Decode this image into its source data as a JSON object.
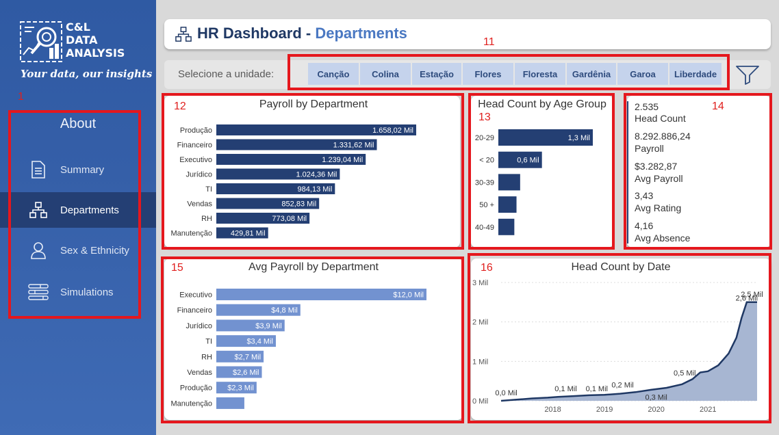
{
  "sidebar": {
    "brand": [
      "C&L",
      "DATA",
      "ANALYSIS"
    ],
    "tagline": "Your data, our insights",
    "annotation": "1",
    "about_label": "About",
    "items": [
      {
        "label": "Summary",
        "icon": "document-icon",
        "active": false
      },
      {
        "label": "Departments",
        "icon": "org-chart-icon",
        "active": true
      },
      {
        "label": "Sex & Ethnicity",
        "icon": "person-icon",
        "active": false
      },
      {
        "label": "Simulations",
        "icon": "sliders-icon",
        "active": false
      }
    ]
  },
  "header": {
    "title_main": "HR Dashboard - ",
    "title_sub": "Departments",
    "icon": "org-chart-icon"
  },
  "filter": {
    "annotation": "11",
    "label": "Selecione a unidade:",
    "units": [
      "Canção",
      "Colina",
      "Estação",
      "Flores",
      "Floresta",
      "Gardênia",
      "Garoa",
      "Liberdade"
    ],
    "icon": "funnel-icon"
  },
  "kpis": {
    "annotation": "14",
    "items": [
      {
        "value": "2.535",
        "label": "Head Count"
      },
      {
        "value": "8.292.886,24",
        "label": "Payroll"
      },
      {
        "value": "$3.282,87",
        "label": "Avg Payroll"
      },
      {
        "value": "3,43",
        "label": "Avg Rating"
      },
      {
        "value": "4,16",
        "label": "Avg Absence"
      }
    ]
  },
  "chart_data": [
    {
      "id": "payroll",
      "annotation": "12",
      "type": "bar",
      "orientation": "horizontal",
      "title": "Payroll by Department",
      "categories": [
        "Produção",
        "Financeiro",
        "Executivo",
        "Jurídico",
        "TI",
        "Vendas",
        "RH",
        "Manutenção"
      ],
      "values": [
        1658.02,
        1331.62,
        1239.04,
        1024.36,
        984.13,
        852.83,
        773.08,
        429.81
      ],
      "data_labels": [
        "1.658,02 Mil",
        "1.331,62 Mil",
        "1.239,04 Mil",
        "1.024,36 Mil",
        "984,13 Mil",
        "852,83 Mil",
        "773,08 Mil",
        "429,81 Mil"
      ],
      "color": "#243f73"
    },
    {
      "id": "agegroup",
      "annotation": "13",
      "type": "bar",
      "orientation": "horizontal",
      "title": "Head Count by Age Group",
      "categories": [
        "20-29",
        "< 20",
        "30-39",
        "50 +",
        "40-49"
      ],
      "values": [
        1.3,
        0.6,
        0.3,
        0.25,
        0.22
      ],
      "data_labels": [
        "1,3 Mil",
        "0,6 Mil",
        "",
        "",
        ""
      ],
      "color": "#243f73"
    },
    {
      "id": "avgpayroll",
      "annotation": "15",
      "type": "bar",
      "orientation": "horizontal",
      "title": "Avg Payroll by Department",
      "categories": [
        "Executivo",
        "Financeiro",
        "Jurídico",
        "TI",
        "RH",
        "Vendas",
        "Produção",
        "Manutenção"
      ],
      "values": [
        12.0,
        4.8,
        3.9,
        3.4,
        2.7,
        2.6,
        2.3,
        1.6
      ],
      "data_labels": [
        "$12,0 Mil",
        "$4,8 Mil",
        "$3,9 Mil",
        "$3,4 Mil",
        "$2,7 Mil",
        "$2,6 Mil",
        "$2,3 Mil",
        ""
      ],
      "color": "#7292d0"
    },
    {
      "id": "headcountdate",
      "annotation": "16",
      "type": "area",
      "title": "Head Count by Date",
      "y_ticks": [
        "0 Mil",
        "1 Mil",
        "2 Mil",
        "3 Mil"
      ],
      "ylim": [
        0,
        3
      ],
      "x_ticks": [
        "2018",
        "2019",
        "2020",
        "2021"
      ],
      "x_tick_values": [
        2018,
        2019,
        2020,
        2021
      ],
      "xlim": [
        2017,
        2021.95
      ],
      "series": [
        {
          "x": [
            2017.0,
            2017.3,
            2017.6,
            2017.9,
            2018.1,
            2018.4,
            2018.7,
            2019.0,
            2019.3,
            2019.6,
            2019.9,
            2020.2,
            2020.5,
            2020.7,
            2020.85,
            2021.0,
            2021.2,
            2021.4,
            2021.55,
            2021.65,
            2021.75,
            2021.85,
            2021.95
          ],
          "y": [
            0.0,
            0.03,
            0.06,
            0.08,
            0.1,
            0.12,
            0.14,
            0.15,
            0.18,
            0.22,
            0.28,
            0.33,
            0.42,
            0.55,
            0.72,
            0.75,
            0.9,
            1.2,
            1.6,
            2.1,
            2.5,
            2.5,
            2.5
          ]
        }
      ],
      "point_labels": [
        {
          "x": 2017.1,
          "y": 0.0,
          "text": "0,0 Mil"
        },
        {
          "x": 2018.25,
          "y": 0.1,
          "text": "0,1 Mil"
        },
        {
          "x": 2018.85,
          "y": 0.1,
          "text": "0,1 Mil"
        },
        {
          "x": 2019.35,
          "y": 0.2,
          "text": "0,2 Mil"
        },
        {
          "x": 2020.0,
          "y": 0.3,
          "text": "0,3 Mil",
          "below": true
        },
        {
          "x": 2020.55,
          "y": 0.5,
          "text": "0,5 Mil"
        },
        {
          "x": 2021.75,
          "y": 2.4,
          "text": "2,6 Mil"
        },
        {
          "x": 2021.85,
          "y": 2.5,
          "text": "2,5 Mil"
        }
      ],
      "color": "#1f3864",
      "fill": "#a7b6d2"
    }
  ]
}
